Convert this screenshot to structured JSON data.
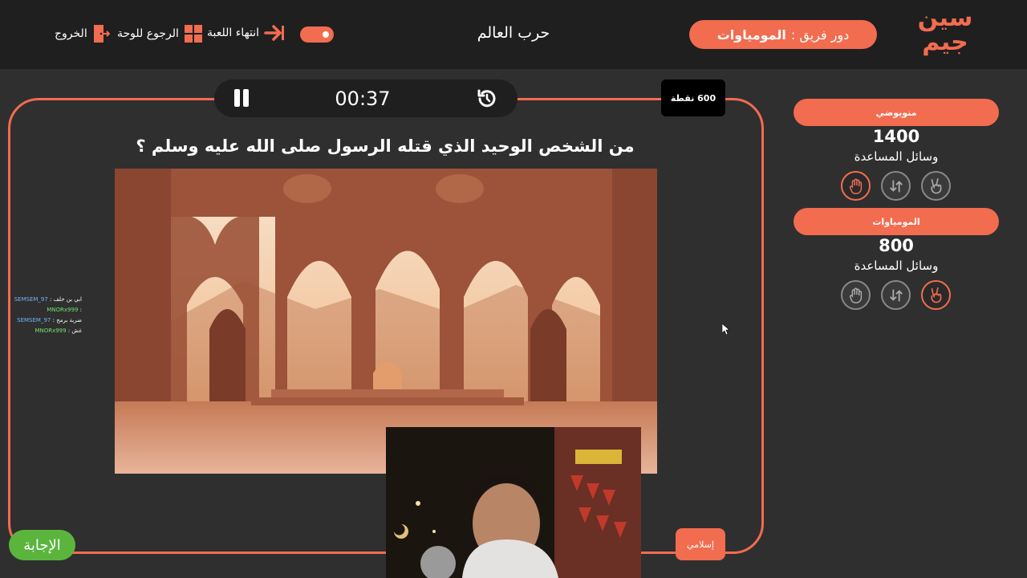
{
  "header": {
    "logo_line1": "سين",
    "logo_line2": "جيم",
    "turn_prefix": "دور فريق :",
    "turn_team": "المومياوات",
    "game_title": "حرب العالم",
    "nav_exit": "الخروج",
    "nav_board": "الرجوع للوحة",
    "nav_end": "انتهاء اللعبة"
  },
  "question_panel": {
    "timer": "00:37",
    "points": "600 نقطة",
    "question": "من الشخص الوحيد الذي قتله الرسول صلى الله عليه وسلم ؟",
    "category": "إسلامي",
    "answer_button": "الإجابة"
  },
  "chat": [
    {
      "user": "SEMSEM_97",
      "message": "ابي بن خلف"
    },
    {
      "user": "MNORx999",
      "message": ""
    },
    {
      "user": "SEMSEM_97",
      "message": "ضربة برمح"
    },
    {
      "user": "MNORx999",
      "message": "غش"
    }
  ],
  "teams": [
    {
      "name": "منويوضي",
      "score": "1400",
      "aids_label": "وسائل المساعدة",
      "active_aid": "hand-icon"
    },
    {
      "name": "المومياوات",
      "score": "800",
      "aids_label": "وسائل المساعدة",
      "active_aid": "peace-icon"
    }
  ],
  "colors": {
    "accent": "#f26c4f",
    "answer_green": "#5bb53d",
    "background": "#2f2f2f",
    "topbar": "#1f1f1f"
  }
}
